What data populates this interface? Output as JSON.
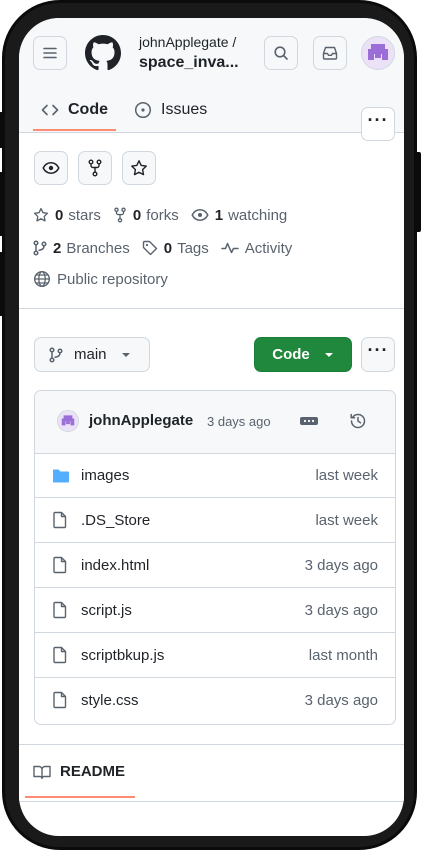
{
  "header": {
    "owner": "johnApplegate /",
    "repo": "space_inva..."
  },
  "tabs": [
    {
      "label": "Code",
      "active": true
    },
    {
      "label": "Issues",
      "active": false
    }
  ],
  "stats": {
    "stars_count": "0",
    "stars_label": "stars",
    "forks_count": "0",
    "forks_label": "forks",
    "watching_count": "1",
    "watching_label": "watching",
    "branches_count": "2",
    "branches_label": "Branches",
    "tags_count": "0",
    "tags_label": "Tags",
    "activity_label": "Activity",
    "visibility_label": "Public repository"
  },
  "branch": {
    "name": "main"
  },
  "code_button": {
    "label": "Code"
  },
  "commit": {
    "author": "johnApplegate",
    "time": "3 days ago"
  },
  "files": [
    {
      "name": "images",
      "time": "last week",
      "type": "folder"
    },
    {
      "name": ".DS_Store",
      "time": "last week",
      "type": "file"
    },
    {
      "name": "index.html",
      "time": "3 days ago",
      "type": "file"
    },
    {
      "name": "script.js",
      "time": "3 days ago",
      "type": "file"
    },
    {
      "name": "scriptbkup.js",
      "time": "last month",
      "type": "file"
    },
    {
      "name": "style.css",
      "time": "3 days ago",
      "type": "file"
    }
  ],
  "readme": {
    "label": "README"
  },
  "colors": {
    "accent_green": "#1f883d",
    "tab_underline": "#fd8c73",
    "folder_blue": "#54aeff"
  }
}
